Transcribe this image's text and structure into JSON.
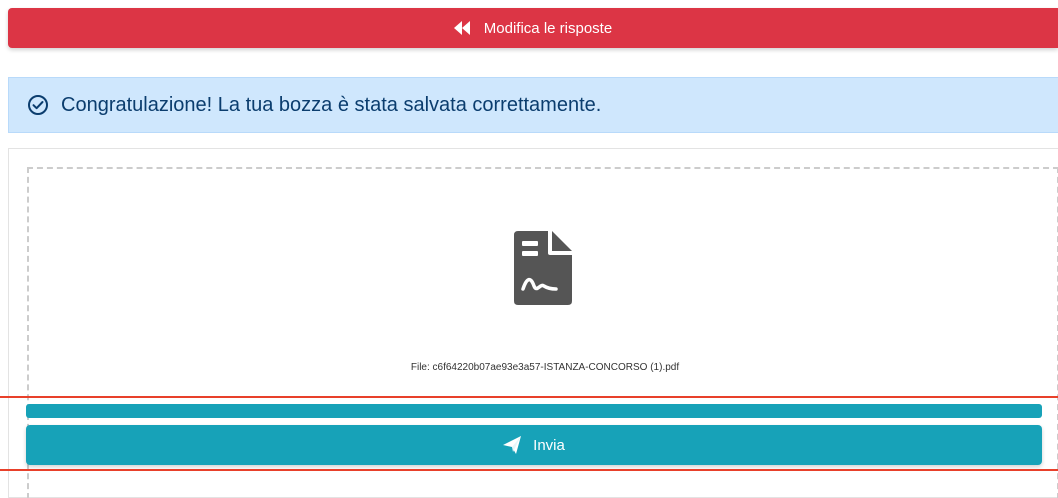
{
  "edit_button": {
    "label": "Modifica le risposte",
    "icon": "fast-backward-icon",
    "color": "#dc3545"
  },
  "alert": {
    "message": "Congratulazione! La tua bozza è stata salvata correttamente.",
    "icon": "check-circle-icon",
    "background": "#cfe7fd",
    "text_color": "#0b3d6e"
  },
  "file_preview": {
    "icon": "file-signature-icon",
    "file_label": "File: c6f64220b07ae93e3a57-ISTANZA-CONCORSO (1).pdf"
  },
  "upload_progress": {
    "fraction": 1.0,
    "color": "#17a2b8"
  },
  "send_button": {
    "label": "Invia",
    "icon": "paper-plane-icon",
    "color": "#17a2b8"
  },
  "highlight": {
    "color": "#e8402a"
  }
}
